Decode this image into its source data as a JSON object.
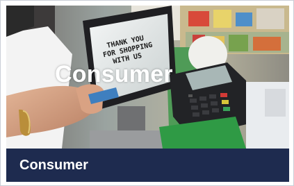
{
  "card": {
    "overlay_title": "Consumer",
    "footer_label": "Consumer"
  },
  "photo": {
    "screen_lines": [
      "THANK YOU",
      "FOR SHOPPING",
      "WITH US"
    ]
  },
  "colors": {
    "footer_bg": "#1e2b4f",
    "text": "#ffffff"
  }
}
